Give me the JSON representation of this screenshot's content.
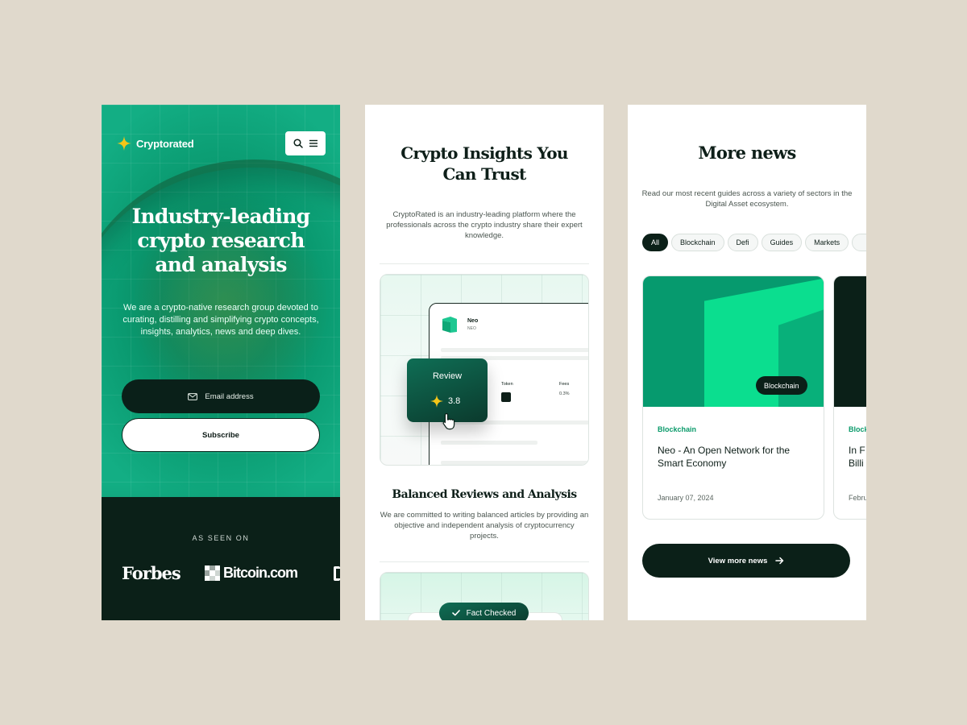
{
  "colors": {
    "accent": "#079e72",
    "dark": "#0b2018",
    "star": "#f5c518",
    "category": "#0a9a6a"
  },
  "hero": {
    "brand": "Cryptorated",
    "title": "Industry-leading crypto research and analysis",
    "description": "We are a crypto-native research group devoted to curating, distilling and simplifying crypto concepts, insights, analytics, news and deep dives.",
    "email_placeholder": "Email address",
    "subscribe_label": "Subscribe",
    "seen_on_label": "AS SEEN ON",
    "brands": [
      "Forbes",
      "Bitcoin.com"
    ]
  },
  "insights": {
    "title": "Crypto Insights You Can Trust",
    "description": "CryptoRated is an industry-leading platform where the professionals across the crypto industry share their expert knowledge.",
    "mock": {
      "coin_name": "Neo",
      "coin_ticker": "NEO",
      "col_token": "Token",
      "col_fees": "Fees",
      "fee_value": "0.3%",
      "review_label": "Review",
      "review_score": "3.8"
    },
    "section_title": "Balanced Reviews and Analysis",
    "section_description": "We are committed to writing balanced articles by providing an objective and independent analysis of cryptocurrency projects.",
    "fact_checked_label": "Fact Checked"
  },
  "news": {
    "title": "More news",
    "description": "Read our most recent guides across a variety of sectors in the Digital Asset ecosystem.",
    "filters": [
      "All",
      "Blockchain",
      "Defi",
      "Guides",
      "Markets"
    ],
    "cards": [
      {
        "badge": "Blockchain",
        "category": "Blockchain",
        "title": "Neo - An Open Network for the Smart Economy",
        "date": "January 07, 2024"
      },
      {
        "category": "Block",
        "title": "In F Billi",
        "date": "Febru"
      }
    ],
    "view_more_label": "View more news"
  }
}
